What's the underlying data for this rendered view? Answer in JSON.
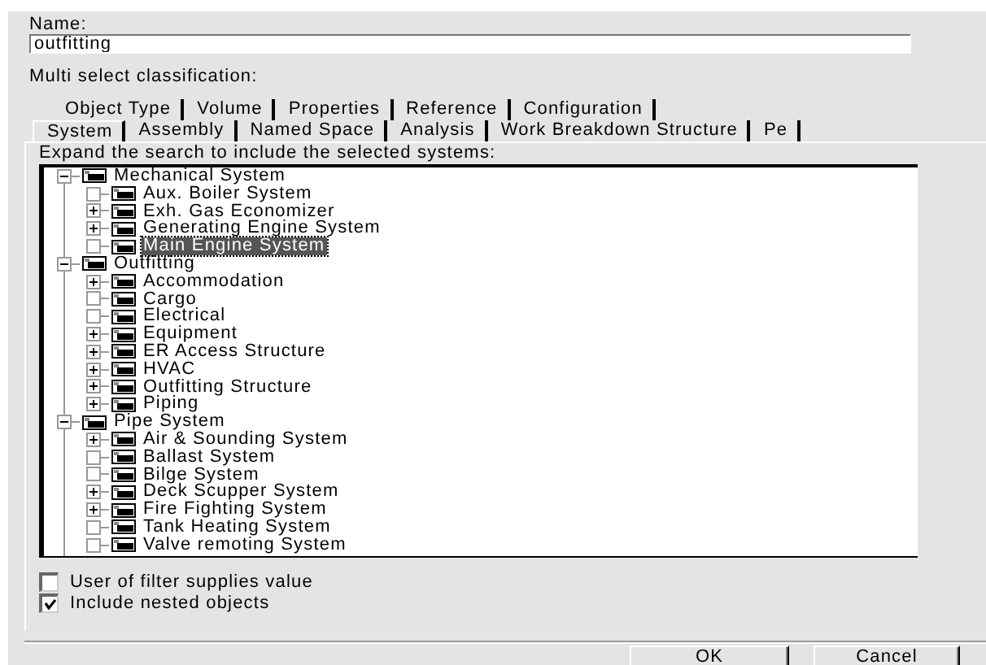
{
  "name_field": {
    "label": "Name:",
    "value": "outfitting"
  },
  "classification_label": "Multi select classification:",
  "tab_rows": [
    [
      {
        "label": "Object Type",
        "selected": false
      },
      {
        "label": "Volume",
        "selected": false
      },
      {
        "label": "Properties",
        "selected": false
      },
      {
        "label": "Reference",
        "selected": false
      },
      {
        "label": "Configuration",
        "selected": false
      }
    ],
    [
      {
        "label": "System",
        "selected": true
      },
      {
        "label": "Assembly",
        "selected": false
      },
      {
        "label": "Named Space",
        "selected": false
      },
      {
        "label": "Analysis",
        "selected": false
      },
      {
        "label": "Work Breakdown Structure",
        "selected": false
      },
      {
        "label": "Pe",
        "selected": false
      }
    ]
  ],
  "tree_label": "Expand the search to include the selected systems:",
  "tree": [
    {
      "label": "Mechanical System",
      "expanded": true,
      "selected": false,
      "children": [
        {
          "label": "Aux. Boiler System",
          "has_children": false,
          "selected": false
        },
        {
          "label": "Exh. Gas Economizer",
          "has_children": true,
          "selected": false
        },
        {
          "label": "Generating Engine System",
          "has_children": true,
          "selected": false
        },
        {
          "label": "Main Engine System",
          "has_children": false,
          "selected": true
        }
      ]
    },
    {
      "label": "Outfitting",
      "expanded": true,
      "selected": false,
      "children": [
        {
          "label": "Accommodation",
          "has_children": true,
          "selected": false
        },
        {
          "label": "Cargo",
          "has_children": false,
          "selected": false
        },
        {
          "label": "Electrical",
          "has_children": false,
          "selected": false
        },
        {
          "label": "Equipment",
          "has_children": true,
          "selected": false
        },
        {
          "label": "ER Access Structure",
          "has_children": true,
          "selected": false
        },
        {
          "label": "HVAC",
          "has_children": true,
          "selected": false
        },
        {
          "label": "Outfitting Structure",
          "has_children": true,
          "selected": false
        },
        {
          "label": "Piping",
          "has_children": true,
          "selected": false
        }
      ]
    },
    {
      "label": "Pipe System",
      "expanded": true,
      "selected": false,
      "children": [
        {
          "label": "Air & Sounding System",
          "has_children": true,
          "selected": false
        },
        {
          "label": "Ballast System",
          "has_children": false,
          "selected": false
        },
        {
          "label": "Bilge System",
          "has_children": false,
          "selected": false
        },
        {
          "label": "Deck Scupper System",
          "has_children": true,
          "selected": false
        },
        {
          "label": "Fire Fighting System",
          "has_children": true,
          "selected": false
        },
        {
          "label": "Tank Heating System",
          "has_children": false,
          "selected": false
        },
        {
          "label": "Valve remoting System",
          "has_children": false,
          "selected": false
        }
      ]
    }
  ],
  "options": [
    {
      "label": "User of filter supplies value",
      "checked": false
    },
    {
      "label": "Include nested objects",
      "checked": true
    }
  ],
  "buttons": [
    "OK",
    "Cancel"
  ]
}
